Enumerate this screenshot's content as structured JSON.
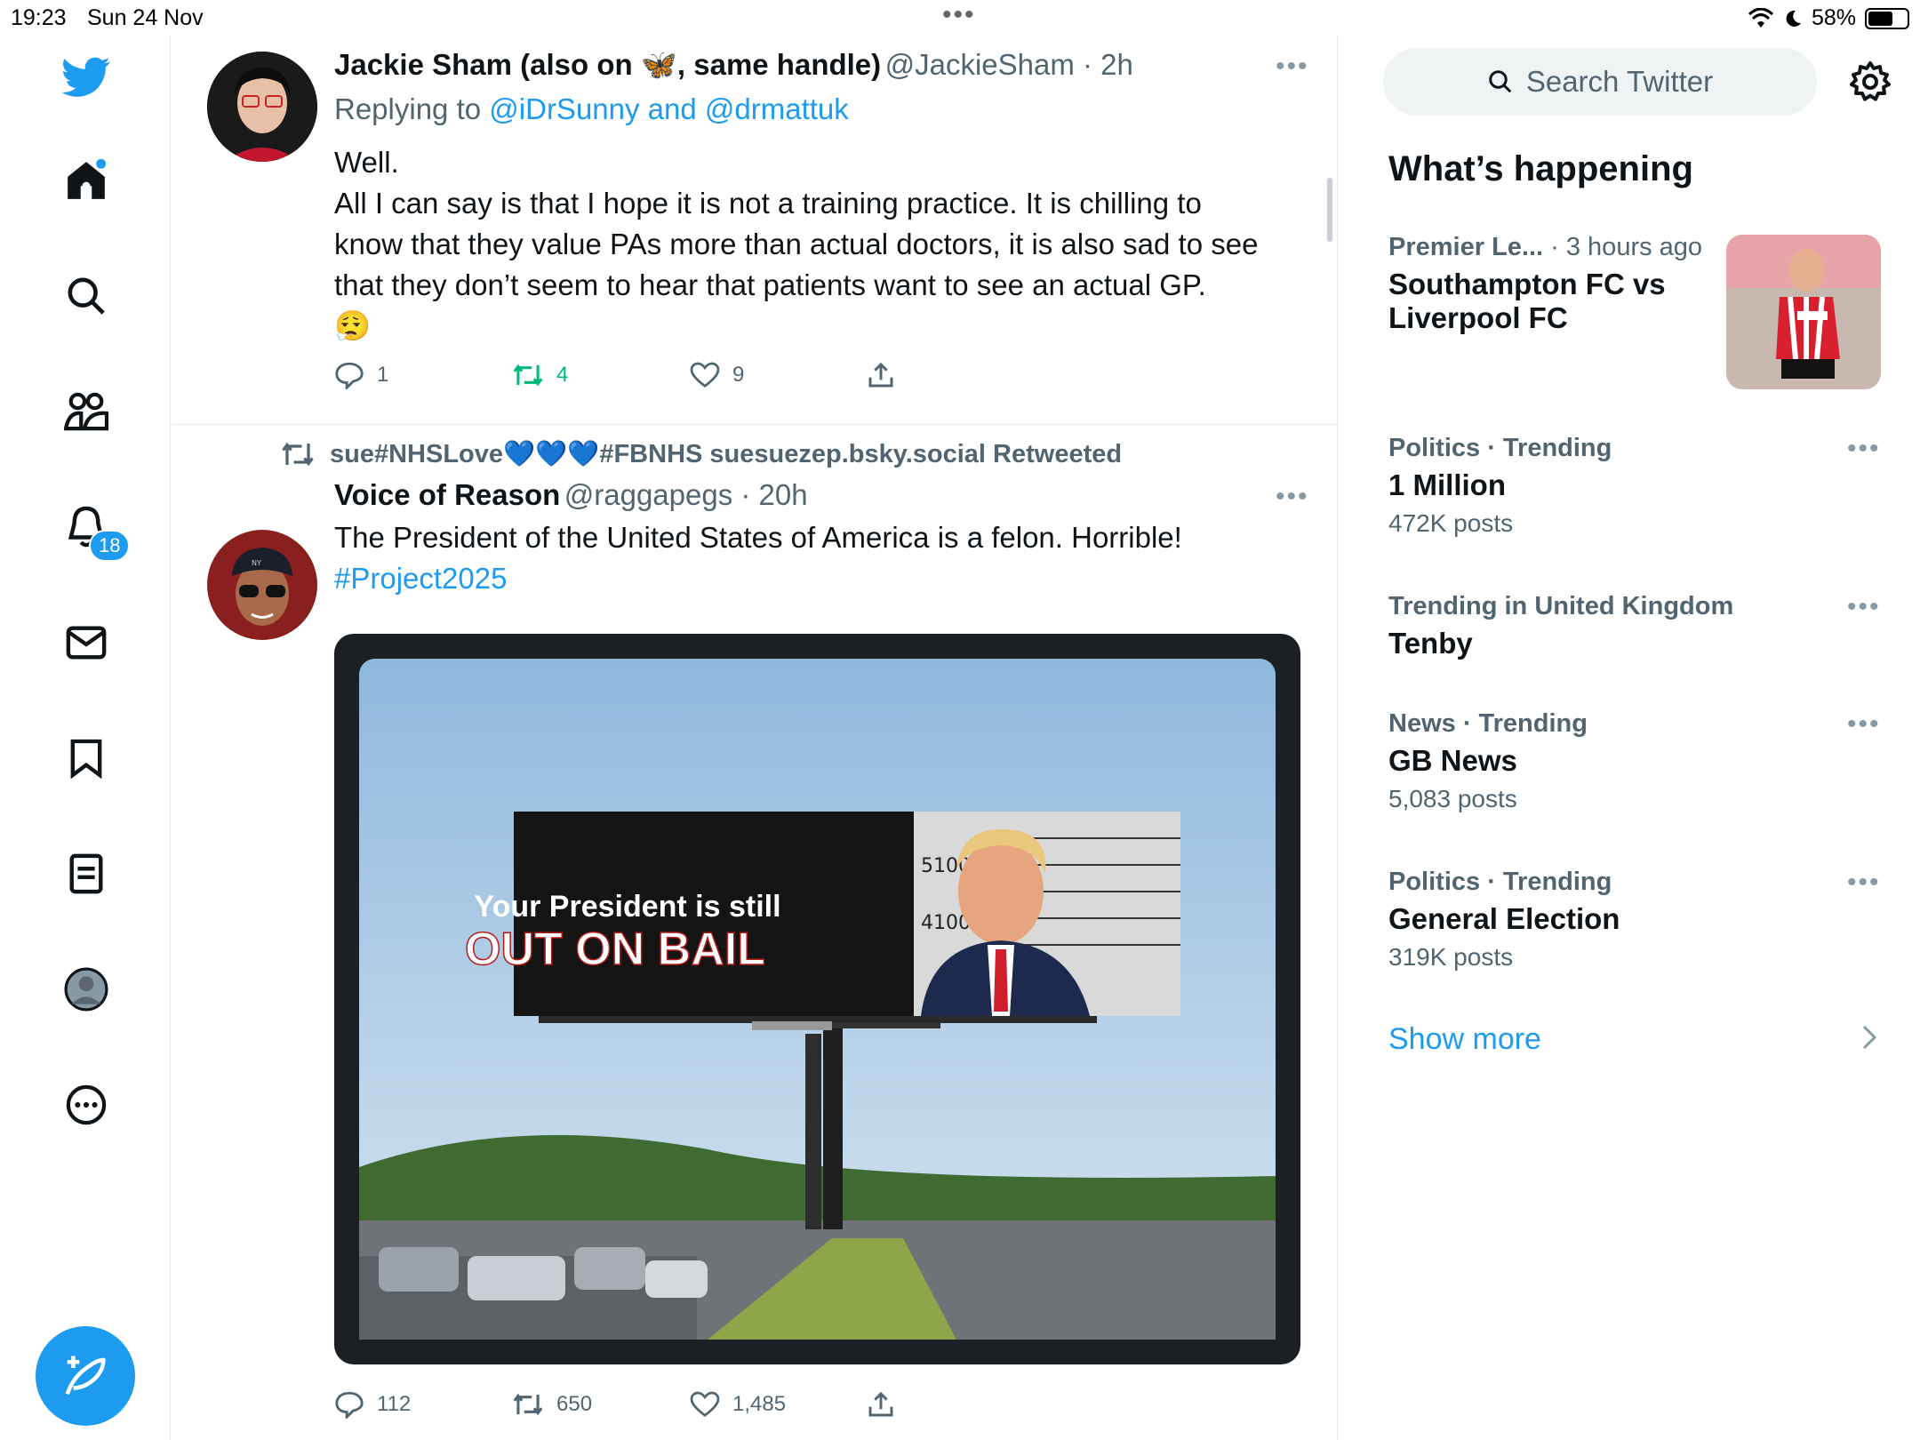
{
  "status_bar": {
    "time": "19:23",
    "date": "Sun 24 Nov",
    "battery": "58%"
  },
  "nav": {
    "notifications_badge": "18"
  },
  "tweets": [
    {
      "author_name": "Jackie Sham (also on 🦋, same handle)",
      "handle": "@JackieSham",
      "time": "2h",
      "replying_label": "Replying to",
      "replying_to": "@iDrSunny and @drmattuk",
      "text_lines": [
        "Well.",
        "All I can say is that I hope it is not a training practice. It is chilling to",
        "know that they value PAs more than actual doctors, it is also sad to see",
        "that they don’t seem to hear that patients want to see an actual GP.",
        "😮‍💨"
      ],
      "replies": "1",
      "retweets": "4",
      "likes": "9"
    },
    {
      "retweet_label": "sue#NHSLove💙💙💙#FBNHS suesuezep.bsky.social Retweeted",
      "author_name": "Voice of Reason",
      "handle": "@raggapegs",
      "time": "20h",
      "text": "The President of the United States of America is a felon. Horrible!",
      "hashtag": "#Project2025",
      "image_text_line1": "Your President is still",
      "image_text_line2": "OUT ON BAIL",
      "mugshot_numbers": [
        "5100",
        "4100"
      ],
      "replies": "112",
      "retweets": "650",
      "likes": "1,485"
    }
  ],
  "sidebar": {
    "search_placeholder": "Search Twitter",
    "heading": "What’s happening",
    "featured": {
      "category": "Premier Le...",
      "time": "· 3 hours ago",
      "title_line1": "Southampton FC vs",
      "title_line2": "Liverpool FC"
    },
    "trends": [
      {
        "meta": "Politics · Trending",
        "title": "1 Million",
        "count": "472K posts"
      },
      {
        "meta": "Trending in United Kingdom",
        "title": "Tenby",
        "count": ""
      },
      {
        "meta": "News · Trending",
        "title": "GB News",
        "count": "5,083 posts"
      },
      {
        "meta": "Politics · Trending",
        "title": "General Election",
        "count": "319K posts"
      }
    ],
    "show_more": "Show more"
  },
  "colors": {
    "accent": "#1d9bf0",
    "retweet_green": "#00ba7c",
    "muted": "#536471"
  }
}
